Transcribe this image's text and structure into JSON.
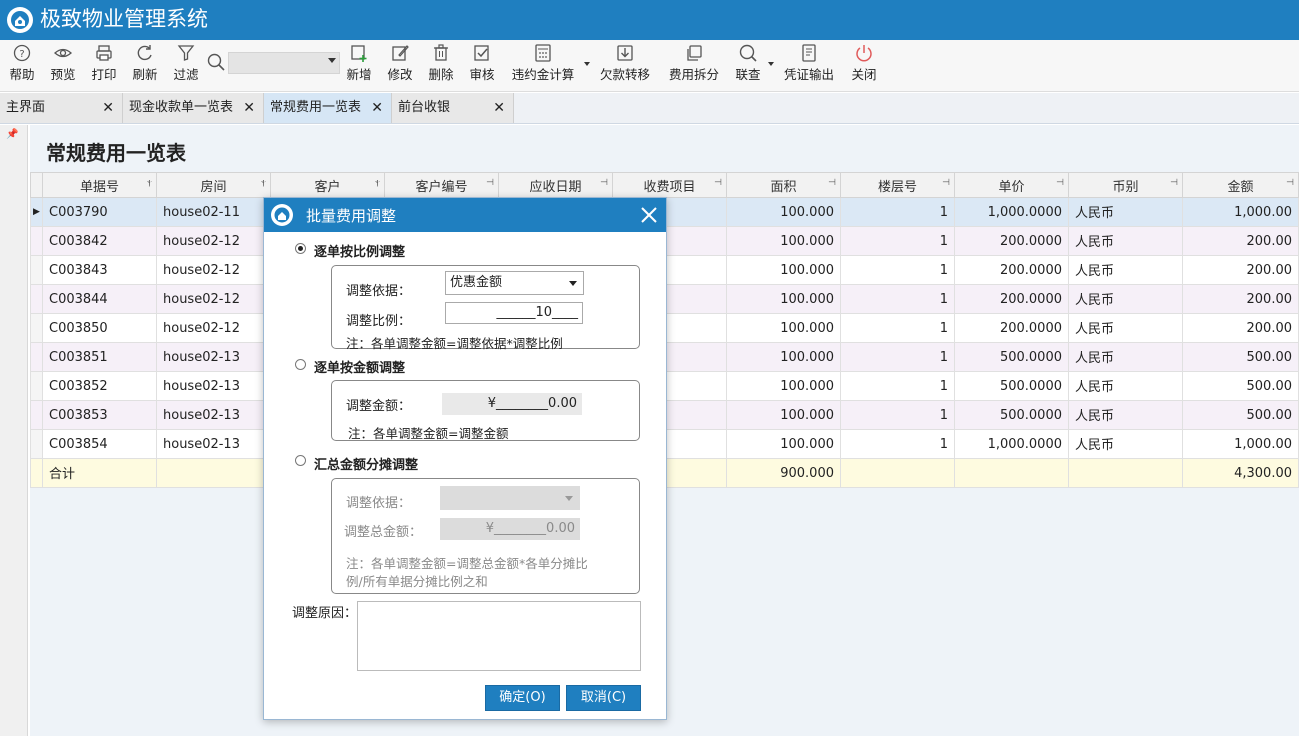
{
  "app": {
    "title": "极致物业管理系统"
  },
  "toolbar": {
    "items": [
      {
        "label": "帮助",
        "icon": "help-icon"
      },
      {
        "label": "预览",
        "icon": "eye-icon"
      },
      {
        "label": "打印",
        "icon": "printer-icon"
      },
      {
        "label": "刷新",
        "icon": "refresh-icon"
      },
      {
        "label": "过滤",
        "icon": "filter-icon"
      },
      {
        "label": "新增",
        "icon": "add-icon"
      },
      {
        "label": "修改",
        "icon": "edit-icon"
      },
      {
        "label": "删除",
        "icon": "trash-icon"
      },
      {
        "label": "审核",
        "icon": "check-icon"
      },
      {
        "label": "违约金计算",
        "icon": "calculator-icon"
      },
      {
        "label": "欠款转移",
        "icon": "download-icon"
      },
      {
        "label": "费用拆分",
        "icon": "copy-icon"
      },
      {
        "label": "联查",
        "icon": "search-icon"
      },
      {
        "label": "凭证输出",
        "icon": "document-icon"
      },
      {
        "label": "关闭",
        "icon": "power-icon"
      }
    ],
    "search_value": ""
  },
  "tabs": [
    {
      "label": "主界面",
      "close": "✕"
    },
    {
      "label": "现金收款单一览表",
      "close": "✕"
    },
    {
      "label": "常规费用一览表",
      "close": "✕"
    },
    {
      "label": "前台收银",
      "close": "✕"
    }
  ],
  "page": {
    "title": "常规费用一览表"
  },
  "grid": {
    "columns": [
      "单据号",
      "房间",
      "客户",
      "客户编号",
      "应收日期",
      "收费项目",
      "面积",
      "楼层号",
      "单价",
      "币别",
      "金额"
    ],
    "rows": [
      [
        "C003790",
        "house02-11",
        "",
        "",
        "",
        "",
        "100.000",
        "1",
        "1,000.0000",
        "人民币",
        "1,000.00"
      ],
      [
        "C003842",
        "house02-12",
        "",
        "",
        "",
        "",
        "100.000",
        "1",
        "200.0000",
        "人民币",
        "200.00"
      ],
      [
        "C003843",
        "house02-12",
        "",
        "",
        "",
        "",
        "100.000",
        "1",
        "200.0000",
        "人民币",
        "200.00"
      ],
      [
        "C003844",
        "house02-12",
        "",
        "",
        "",
        "",
        "100.000",
        "1",
        "200.0000",
        "人民币",
        "200.00"
      ],
      [
        "C003850",
        "house02-12",
        "",
        "",
        "",
        "",
        "100.000",
        "1",
        "200.0000",
        "人民币",
        "200.00"
      ],
      [
        "C003851",
        "house02-13",
        "",
        "",
        "",
        "",
        "100.000",
        "1",
        "500.0000",
        "人民币",
        "500.00"
      ],
      [
        "C003852",
        "house02-13",
        "",
        "",
        "",
        "",
        "100.000",
        "1",
        "500.0000",
        "人民币",
        "500.00"
      ],
      [
        "C003853",
        "house02-13",
        "",
        "",
        "",
        "",
        "100.000",
        "1",
        "500.0000",
        "人民币",
        "500.00"
      ],
      [
        "C003854",
        "house02-13",
        "",
        "",
        "",
        "",
        "100.000",
        "1",
        "1,000.0000",
        "人民币",
        "1,000.00"
      ]
    ],
    "summary": {
      "label": "合计",
      "area": "900.000",
      "amount": "4,300.00"
    },
    "row_marker": "▶"
  },
  "dialog": {
    "title": "批量费用调整",
    "opt1": {
      "label": "逐单按比例调整",
      "basis_label": "调整依据：",
      "basis_value": "优惠金额",
      "ratio_label": "调整比例：",
      "ratio_value": "______10____",
      "note": "注：各单调整金额=调整依据*调整比例"
    },
    "opt2": {
      "label": "逐单按金额调整",
      "amount_label": "调整金额：",
      "amount_value": "¥________0.00",
      "note": "注：各单调整金额=调整金额"
    },
    "opt3": {
      "label": "汇总金额分摊调整",
      "basis_label": "调整依据：",
      "basis_value": "",
      "total_label": "调整总金额：",
      "total_value": "¥________0.00",
      "note_line1": "注：各单调整金额=调整总金额*各单分摊比",
      "note_line2": "例/所有单据分摊比例之和"
    },
    "reason_label": "调整原因：",
    "reason_value": "",
    "ok": "确定(O)",
    "cancel": "取消(C)"
  }
}
